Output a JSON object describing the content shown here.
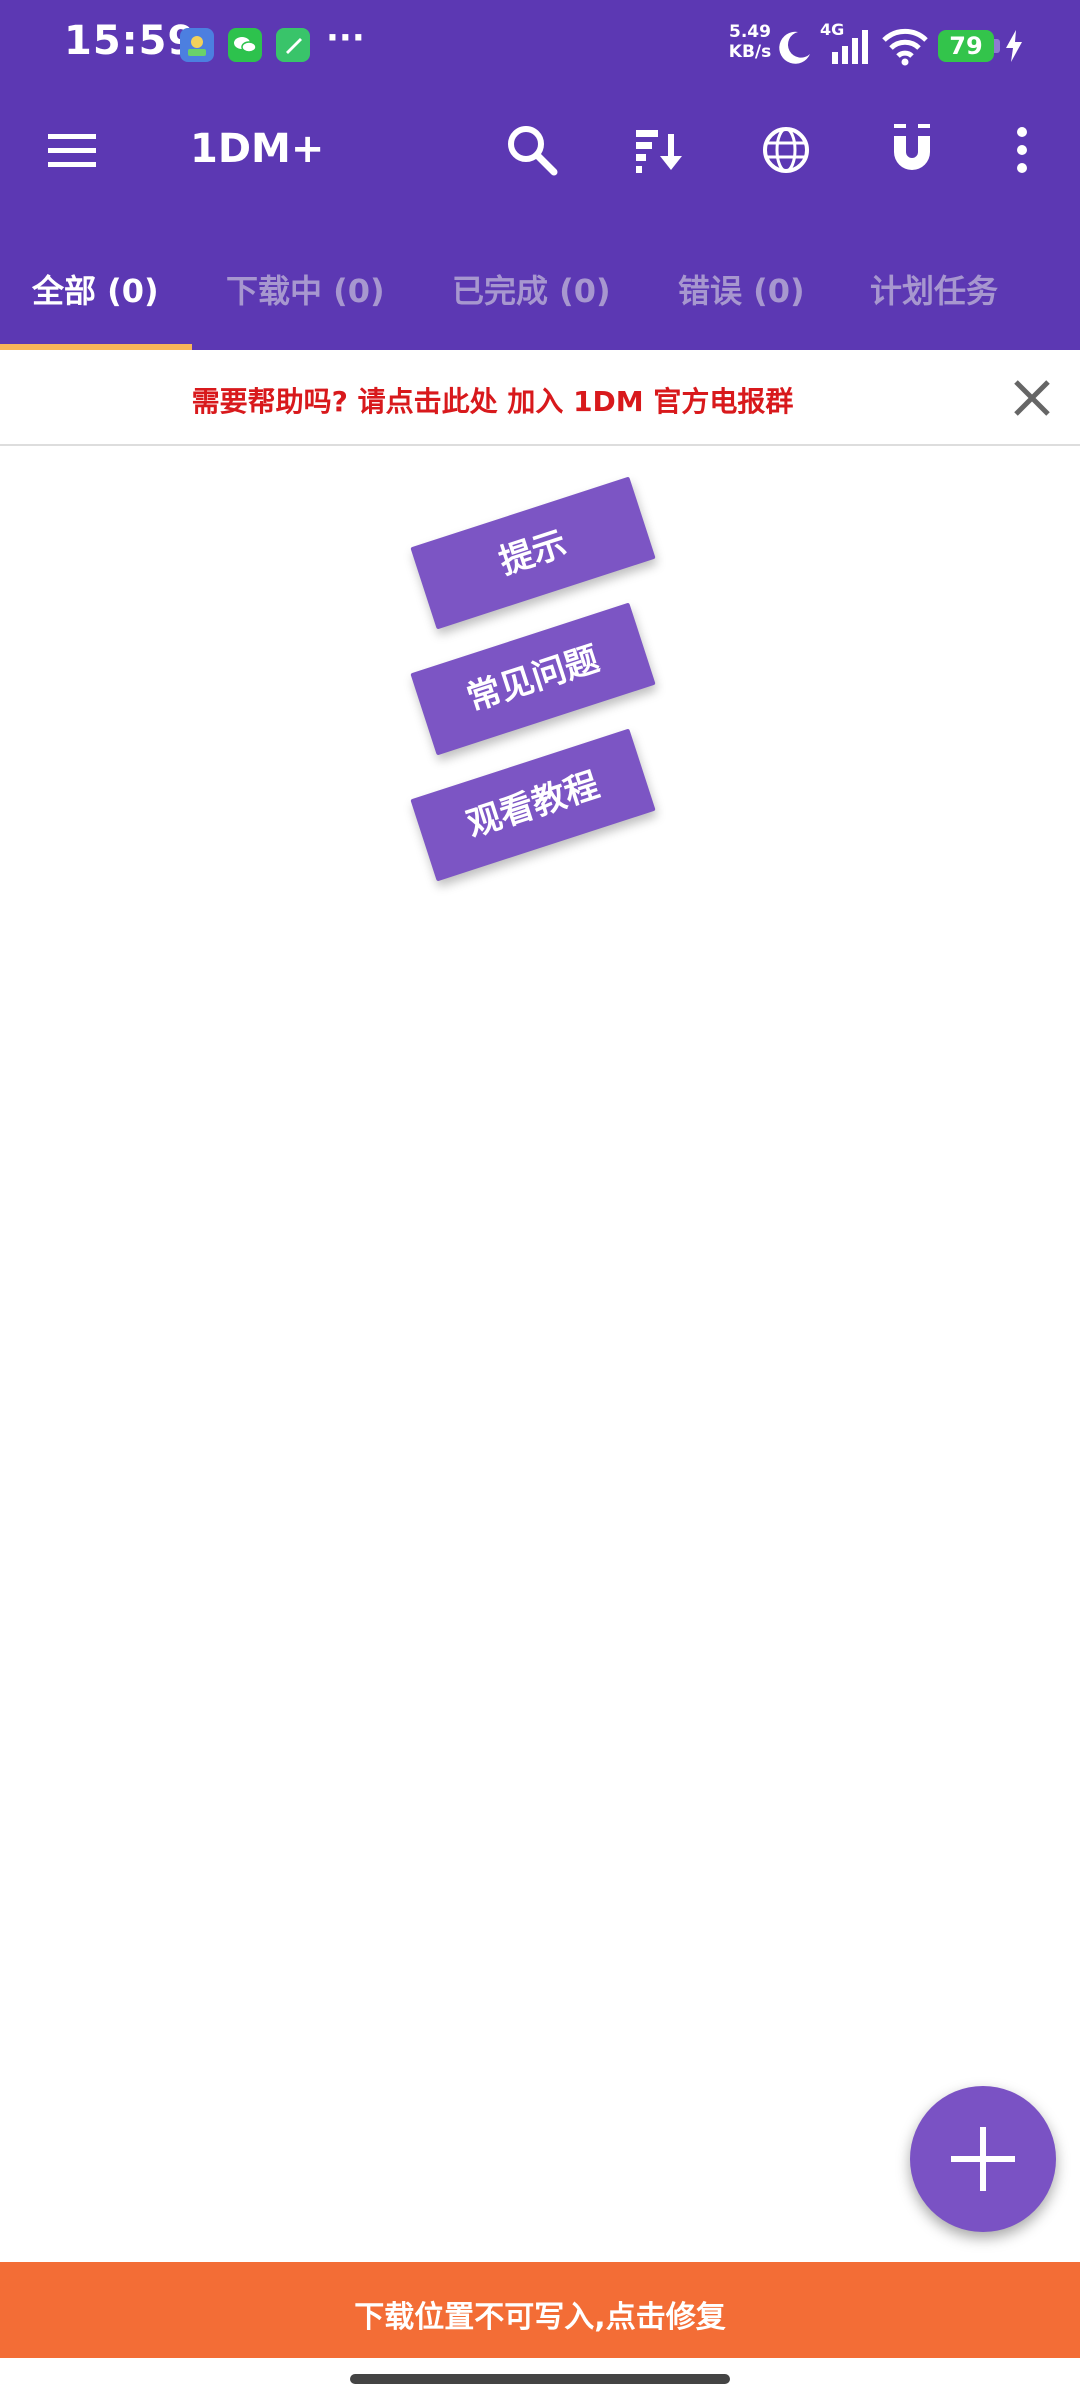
{
  "status_bar": {
    "time": "15:59",
    "net_speed_value": "5.49",
    "net_speed_unit": "KB/s",
    "network_type": "4G",
    "battery_level": "79",
    "overflow": "···",
    "notification_icons": [
      "photos-app-icon",
      "wechat-icon",
      "tools-app-icon"
    ]
  },
  "toolbar": {
    "title": "1DM+",
    "icons": [
      "menu-icon",
      "search-icon",
      "sort-icon",
      "browser-globe-icon",
      "magnet-icon",
      "more-vert-icon"
    ]
  },
  "tabs": [
    {
      "label": "全部 (0)",
      "active": true
    },
    {
      "label": "下载中 (0)",
      "active": false
    },
    {
      "label": "已完成 (0)",
      "active": false
    },
    {
      "label": "错误 (0)",
      "active": false
    },
    {
      "label": "计划任务",
      "active": false
    }
  ],
  "help_banner": {
    "text": "需要帮助吗? 请点击此处 加入 1DM 官方电报群"
  },
  "help_buttons": [
    "提示",
    "常见问题",
    "观看教程"
  ],
  "fab": {
    "icon": "add-icon"
  },
  "bottom_banner": {
    "text": "下载位置不可写入,点击修复"
  },
  "colors": {
    "primary": "#5c38b3",
    "accent_purple": "#7c55c4",
    "tab_indicator": "#f7b55a",
    "warning_orange": "#f36d36",
    "help_red": "#d8191c"
  }
}
